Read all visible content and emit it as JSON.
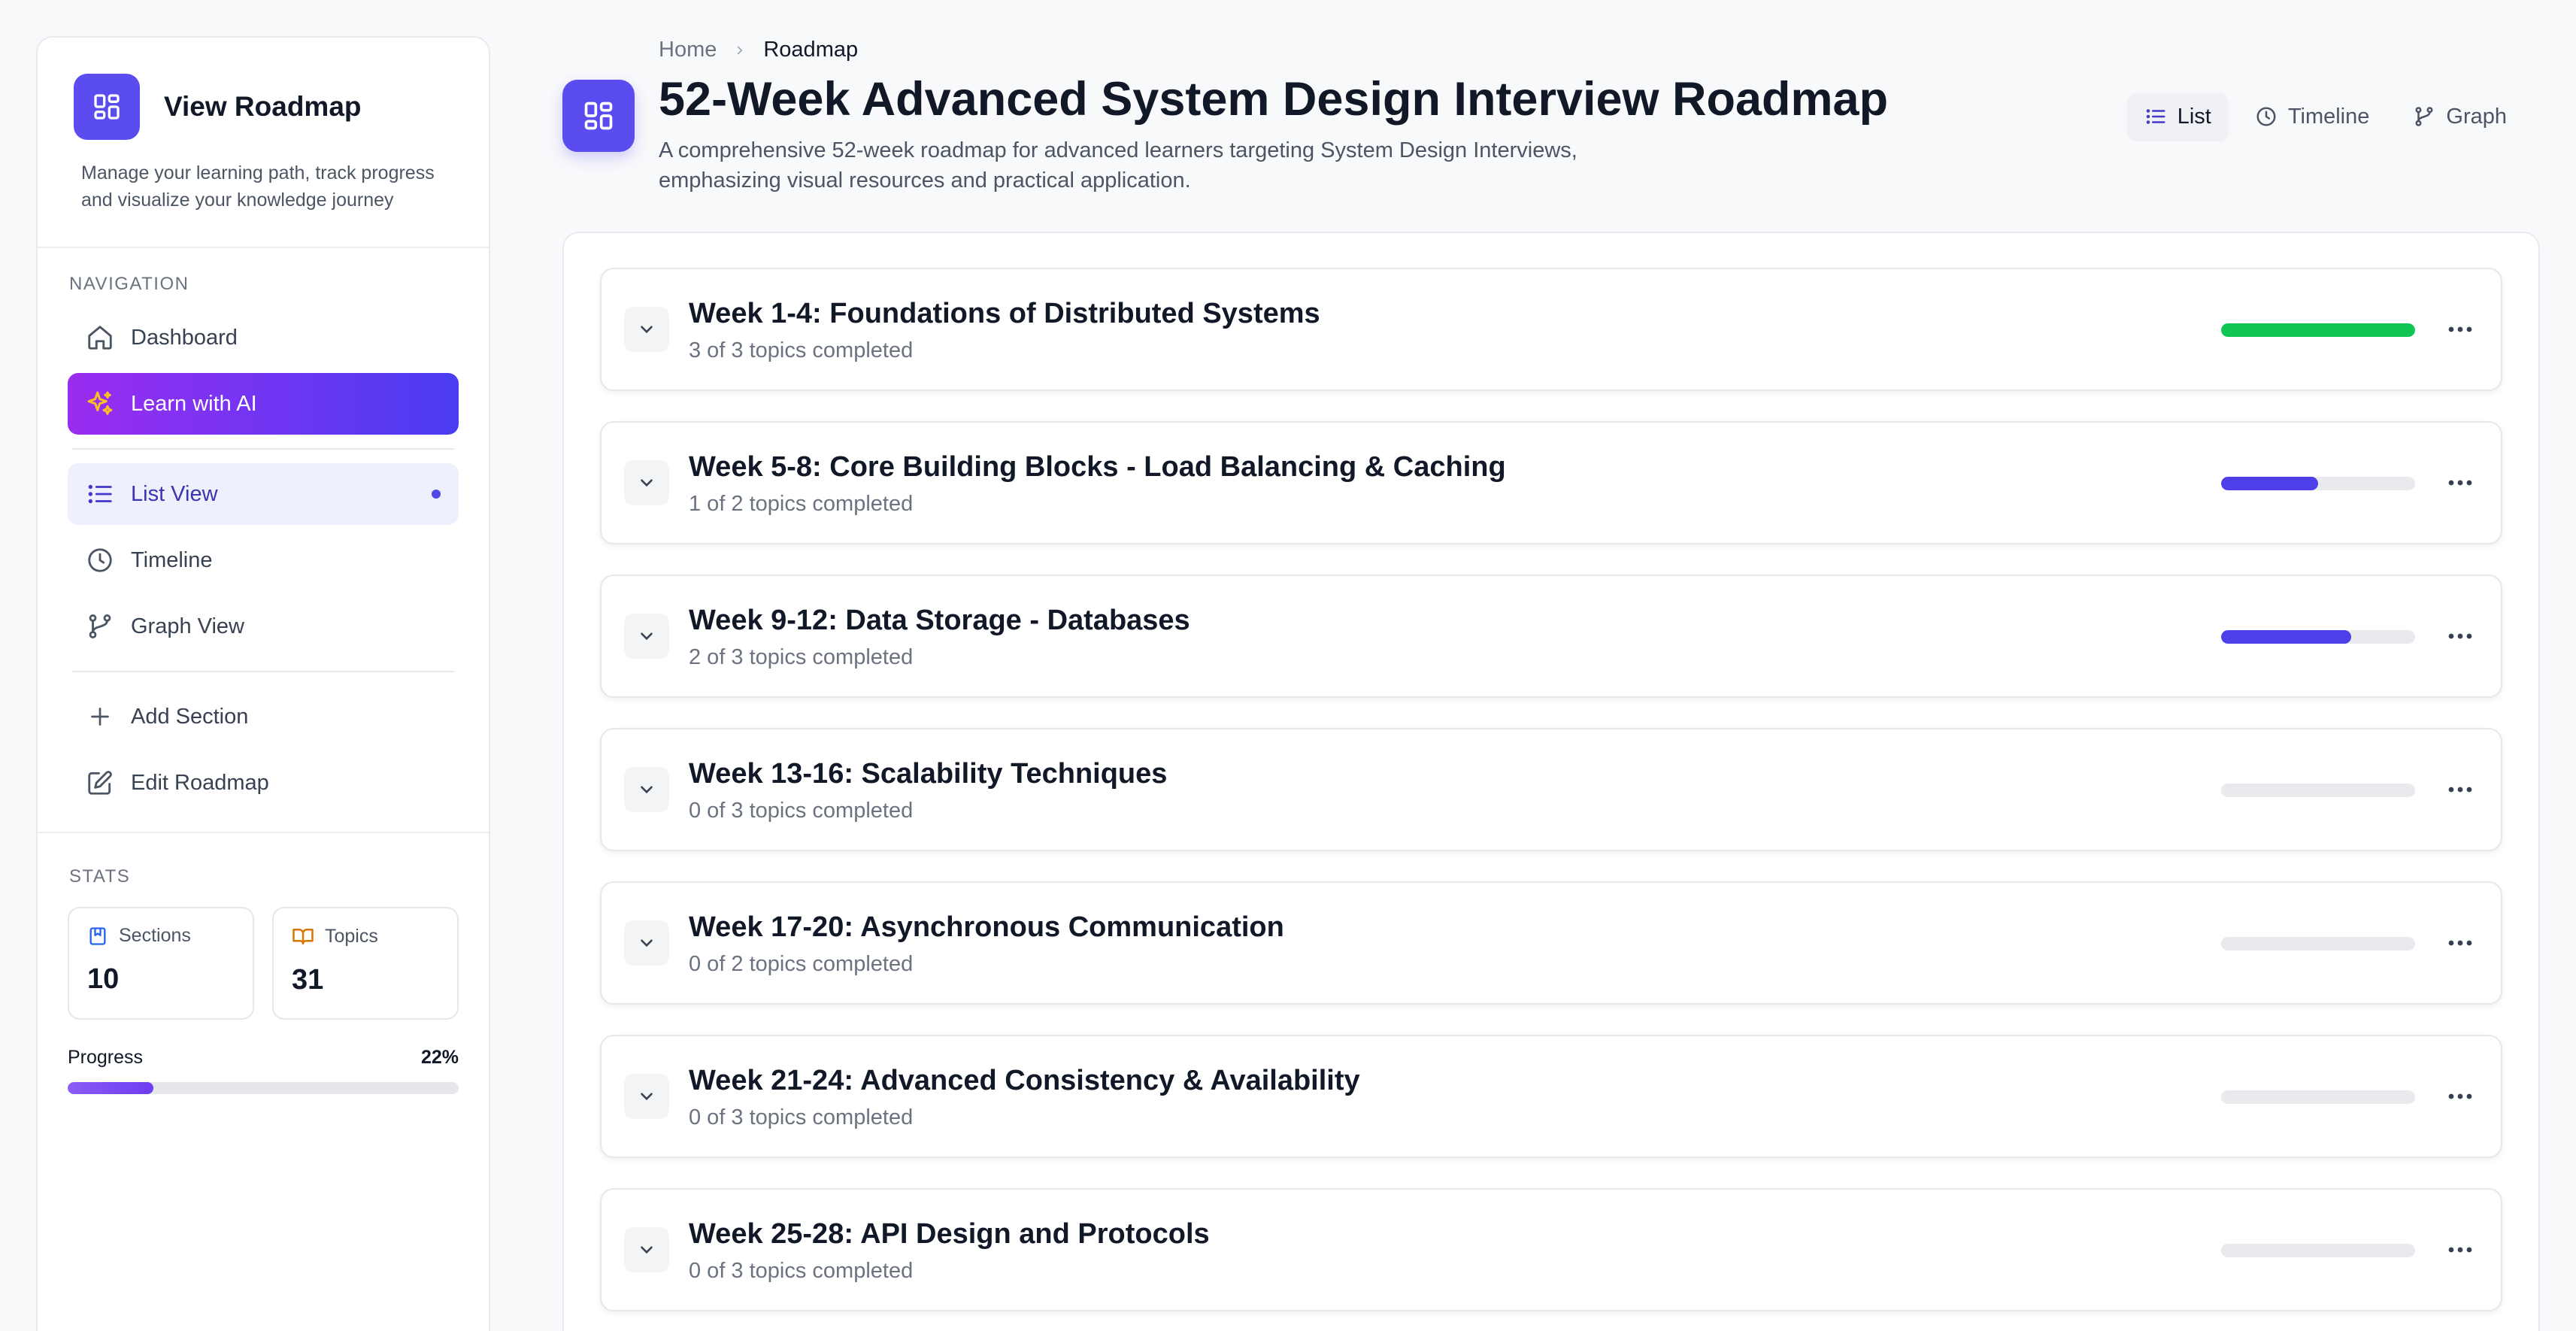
{
  "sidebar": {
    "title": "View Roadmap",
    "description": "Manage your learning path, track progress and visualize your knowledge journey",
    "nav_label": "NAVIGATION",
    "dashboard": "Dashboard",
    "learn_ai": "Learn with AI",
    "list_view": "List View",
    "timeline": "Timeline",
    "graph_view": "Graph View",
    "add_section": "Add Section",
    "edit_roadmap": "Edit Roadmap",
    "stats_label": "STATS",
    "sections_label": "Sections",
    "sections_value": "10",
    "topics_label": "Topics",
    "topics_value": "31",
    "progress_label": "Progress",
    "progress_value": "22%",
    "progress_fraction": 0.22
  },
  "breadcrumb": {
    "home": "Home",
    "current": "Roadmap"
  },
  "header": {
    "title": "52-Week Advanced System Design Interview Roadmap",
    "description": "A comprehensive 52-week roadmap for advanced learners targeting System Design Interviews, emphasizing visual resources and practical application."
  },
  "view_switch": {
    "list": "List",
    "timeline": "Timeline",
    "graph": "Graph"
  },
  "colors": {
    "accent": "#4f46e5",
    "complete": "#10c553",
    "track": "#e9eaee"
  },
  "sections": [
    {
      "title": "Week 1-4: Foundations of Distributed Systems",
      "status": "3 of 3 topics completed",
      "progress": 1.0,
      "color": "#10c553"
    },
    {
      "title": "Week 5-8: Core Building Blocks - Load Balancing & Caching",
      "status": "1 of 2 topics completed",
      "progress": 0.5,
      "color": "#4f3fe8"
    },
    {
      "title": "Week 9-12: Data Storage - Databases",
      "status": "2 of 3 topics completed",
      "progress": 0.67,
      "color": "#4f3fe8"
    },
    {
      "title": "Week 13-16: Scalability Techniques",
      "status": "0 of 3 topics completed",
      "progress": 0,
      "color": "#4f3fe8"
    },
    {
      "title": "Week 17-20: Asynchronous Communication",
      "status": "0 of 2 topics completed",
      "progress": 0,
      "color": "#4f3fe8"
    },
    {
      "title": "Week 21-24: Advanced Consistency & Availability",
      "status": "0 of 3 topics completed",
      "progress": 0,
      "color": "#4f3fe8"
    },
    {
      "title": "Week 25-28: API Design and Protocols",
      "status": "0 of 3 topics completed",
      "progress": 0,
      "color": "#4f3fe8"
    }
  ]
}
